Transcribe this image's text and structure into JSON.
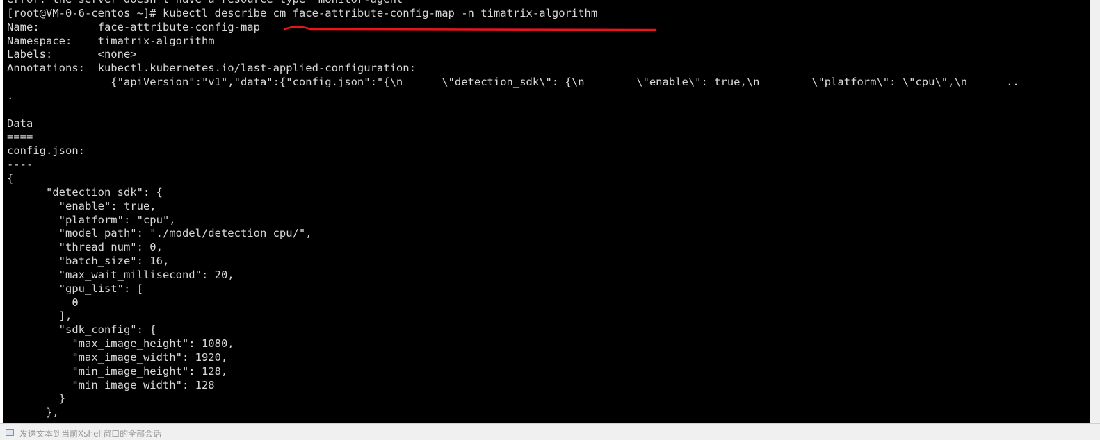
{
  "terminal": {
    "lines": [
      "error: the server doesn't have a resource type \"monitor-agent\"",
      "[root@VM-0-6-centos ~]# kubectl describe cm face-attribute-config-map -n timatrix-algorithm",
      "Name:         face-attribute-config-map",
      "Namespace:    timatrix-algorithm",
      "Labels:       <none>",
      "Annotations:  kubectl.kubernetes.io/last-applied-configuration:",
      "                {\"apiVersion\":\"v1\",\"data\":{\"config.json\":\"{\\n      \\\"detection_sdk\\\": {\\n        \\\"enable\\\": true,\\n        \\\"platform\\\": \\\"cpu\\\",\\n      ..",
      ".",
      "",
      "Data",
      "====",
      "config.json:",
      "----",
      "{",
      "      \"detection_sdk\": {",
      "        \"enable\": true,",
      "        \"platform\": \"cpu\",",
      "        \"model_path\": \"./model/detection_cpu/\",",
      "        \"thread_num\": 0,",
      "        \"batch_size\": 16,",
      "        \"max_wait_millisecond\": 20,",
      "        \"gpu_list\": [",
      "          0",
      "        ],",
      "        \"sdk_config\": {",
      "          \"max_image_height\": 1080,",
      "          \"max_image_width\": 1920,",
      "          \"min_image_height\": 128,",
      "          \"min_image_width\": 128",
      "        }",
      "      },"
    ]
  },
  "status_bar": {
    "text": "发送文本到当前Xshell窗口的全部会话",
    "icon": "send-session-icon"
  },
  "colors": {
    "terminal_background": "#000000",
    "terminal_text": "#d8d8d8",
    "annotation_stroke": "#e8141e",
    "status_bar_background": "#f0f0f0"
  }
}
